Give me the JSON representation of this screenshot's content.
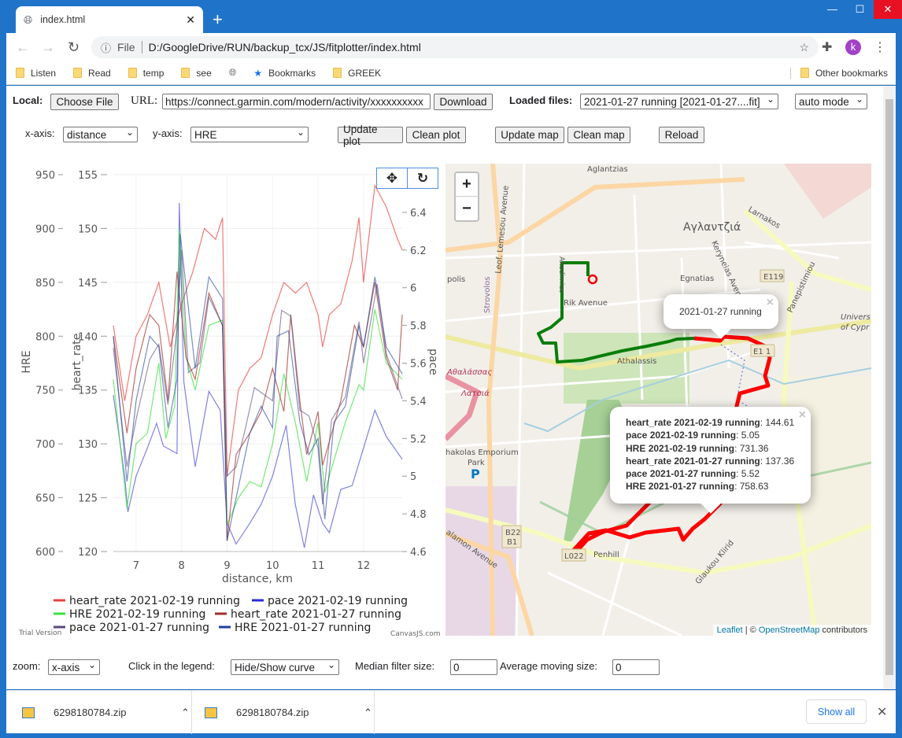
{
  "browser": {
    "tab_title": "index.html",
    "omnibox": {
      "scheme_label": "File",
      "url": "D:/GoogleDrive/RUN/backup_tcx/JS/fitplotter/index.html"
    },
    "bookmarks": [
      "Listen",
      "Read",
      "temp",
      "see",
      "Bookmarks",
      "GREEK"
    ],
    "other_bookmarks": "Other bookmarks",
    "profile_initial": "k",
    "accent": "#1f74c9"
  },
  "controls": {
    "local_label": "Local:",
    "choose_file": "Choose File",
    "url_label": "URL:",
    "url_value": "https://connect.garmin.com/modern/activity/xxxxxxxxxx",
    "download": "Download",
    "loaded_label": "Loaded files:",
    "loaded_value": "2021-01-27 running [2021-01-27....fit]",
    "mode_value": "auto mode",
    "xaxis_label": "x-axis:",
    "xaxis_value": "distance",
    "yaxis_label": "y-axis:",
    "yaxis_value": "HRE",
    "update_plot": "Update plot",
    "clean_plot": "Clean plot",
    "update_map": "Update map",
    "clean_map": "Clean map",
    "reload": "Reload",
    "zoom_label": "zoom:",
    "zoom_value": "x-axis",
    "legend_label": "Click in the legend:",
    "legend_value": "Hide/Show curve",
    "median_label": "Median filter size:",
    "median_value": "0",
    "avg_label": "Average moving size:",
    "avg_value": "0"
  },
  "chart_data": {
    "type": "line",
    "xlabel": "distance, km",
    "xlim": [
      6.5,
      12.85
    ],
    "xticks": [
      7,
      8,
      9,
      10,
      11,
      12
    ],
    "axes": {
      "HRE": {
        "label": "HRE",
        "range": [
          600,
          950
        ],
        "ticks": [
          600,
          650,
          700,
          750,
          800,
          850,
          900,
          950
        ]
      },
      "heart_rate": {
        "label": "heart_rate",
        "range": [
          120,
          155
        ],
        "ticks": [
          120,
          125,
          130,
          135,
          140,
          145,
          150,
          155
        ]
      },
      "pace": {
        "label": "pace",
        "range": [
          4.6,
          6.6
        ],
        "ticks": [
          "4.6",
          "4.8",
          "5",
          "5.2",
          "5.4",
          "5.6",
          "5.8",
          "6",
          "6.2",
          "6.4"
        ]
      }
    },
    "grid": true,
    "legend_placement": "bottom",
    "watermark_left": "Trial Version",
    "watermark_right": "CanvasJS.com",
    "series": [
      {
        "name": "heart_rate 2021-02-19 running",
        "axis": "heart_rate",
        "color": "#e8403f",
        "points": [
          [
            6.5,
            141
          ],
          [
            6.75,
            134
          ],
          [
            7.0,
            140
          ],
          [
            7.25,
            142
          ],
          [
            7.5,
            145
          ],
          [
            7.75,
            139
          ],
          [
            8.0,
            143
          ],
          [
            8.25,
            146
          ],
          [
            8.5,
            150
          ],
          [
            8.75,
            149
          ],
          [
            8.9,
            151
          ],
          [
            9.0,
            127
          ],
          [
            9.25,
            135
          ],
          [
            9.5,
            137
          ],
          [
            9.75,
            138
          ],
          [
            10.0,
            142
          ],
          [
            10.25,
            145
          ],
          [
            10.5,
            144
          ],
          [
            10.75,
            145
          ],
          [
            11.0,
            142
          ],
          [
            11.1,
            139
          ],
          [
            11.25,
            142
          ],
          [
            11.5,
            143
          ],
          [
            11.75,
            147
          ],
          [
            11.9,
            151
          ],
          [
            12.0,
            145
          ],
          [
            12.25,
            154
          ],
          [
            12.5,
            152
          ],
          [
            12.75,
            149
          ],
          [
            12.85,
            148
          ]
        ]
      },
      {
        "name": "pace 2021-02-19 running",
        "axis": "pace",
        "color": "#2b2bd6",
        "points": [
          [
            6.5,
            5.43
          ],
          [
            6.75,
            5.0
          ],
          [
            6.82,
            4.81
          ],
          [
            7.0,
            5.0
          ],
          [
            7.25,
            5.15
          ],
          [
            7.45,
            5.28
          ],
          [
            7.6,
            5.16
          ],
          [
            7.9,
            5.12
          ],
          [
            7.95,
            6.45
          ],
          [
            8.05,
            5.5
          ],
          [
            8.3,
            5.05
          ],
          [
            8.6,
            5.45
          ],
          [
            8.85,
            5.35
          ],
          [
            9.0,
            4.75
          ],
          [
            9.2,
            4.64
          ],
          [
            9.5,
            4.75
          ],
          [
            9.75,
            4.85
          ],
          [
            10.0,
            5.0
          ],
          [
            10.3,
            5.27
          ],
          [
            10.5,
            4.85
          ],
          [
            10.7,
            4.62
          ],
          [
            10.9,
            4.9
          ],
          [
            11.1,
            4.75
          ],
          [
            11.25,
            4.7
          ],
          [
            11.5,
            4.93
          ],
          [
            11.75,
            4.95
          ],
          [
            12.0,
            5.15
          ],
          [
            12.25,
            5.35
          ],
          [
            12.5,
            5.21
          ],
          [
            12.85,
            5.09
          ]
        ]
      },
      {
        "name": "HRE 2021-02-19 running",
        "axis": "HRE",
        "color": "#3be03b",
        "points": [
          [
            6.5,
            760
          ],
          [
            6.8,
            640
          ],
          [
            7.0,
            700
          ],
          [
            7.25,
            710
          ],
          [
            7.5,
            775
          ],
          [
            7.65,
            705
          ],
          [
            7.85,
            735
          ],
          [
            7.95,
            900
          ],
          [
            8.1,
            780
          ],
          [
            8.3,
            750
          ],
          [
            8.6,
            810
          ],
          [
            8.9,
            815
          ],
          [
            9.0,
            625
          ],
          [
            9.25,
            650
          ],
          [
            9.5,
            665
          ],
          [
            9.75,
            660
          ],
          [
            10.0,
            700
          ],
          [
            10.25,
            765
          ],
          [
            10.5,
            720
          ],
          [
            10.75,
            665
          ],
          [
            11.0,
            720
          ],
          [
            11.15,
            655
          ],
          [
            11.35,
            685
          ],
          [
            11.6,
            720
          ],
          [
            11.9,
            755
          ],
          [
            12.0,
            750
          ],
          [
            12.25,
            825
          ],
          [
            12.5,
            775
          ],
          [
            12.85,
            760
          ]
        ]
      },
      {
        "name": "heart_rate 2021-01-27 running",
        "axis": "heart_rate",
        "color": "#a3302a",
        "points": [
          [
            6.5,
            140
          ],
          [
            6.8,
            131
          ],
          [
            7.0,
            137
          ],
          [
            7.3,
            142
          ],
          [
            7.5,
            141
          ],
          [
            7.7,
            134
          ],
          [
            7.9,
            146
          ],
          [
            8.1,
            138
          ],
          [
            8.3,
            136
          ],
          [
            8.6,
            144
          ],
          [
            8.9,
            141
          ],
          [
            9.0,
            121
          ],
          [
            9.2,
            129
          ],
          [
            9.5,
            131
          ],
          [
            9.75,
            133
          ],
          [
            10.0,
            137
          ],
          [
            10.25,
            133
          ],
          [
            10.4,
            142
          ],
          [
            10.6,
            134
          ],
          [
            10.75,
            129
          ],
          [
            11.0,
            133
          ],
          [
            11.1,
            128
          ],
          [
            11.3,
            131
          ],
          [
            11.5,
            134
          ],
          [
            11.8,
            141
          ],
          [
            12.0,
            139
          ],
          [
            12.25,
            145
          ],
          [
            12.5,
            138
          ],
          [
            12.75,
            135
          ],
          [
            12.85,
            142
          ]
        ]
      },
      {
        "name": "pace 2021-01-27 running",
        "axis": "pace",
        "color": "#5a4a7a",
        "points": [
          [
            6.5,
            5.68
          ],
          [
            6.8,
            5.05
          ],
          [
            7.0,
            5.3
          ],
          [
            7.3,
            5.62
          ],
          [
            7.5,
            5.7
          ],
          [
            7.7,
            5.38
          ],
          [
            7.9,
            5.78
          ],
          [
            8.0,
            6.2
          ],
          [
            8.15,
            5.55
          ],
          [
            8.4,
            5.6
          ],
          [
            8.6,
            5.95
          ],
          [
            8.9,
            5.8
          ],
          [
            9.0,
            5.0
          ],
          [
            9.2,
            5.05
          ],
          [
            9.4,
            5.25
          ],
          [
            9.6,
            5.47
          ],
          [
            10.0,
            5.4
          ],
          [
            10.2,
            5.88
          ],
          [
            10.4,
            5.85
          ],
          [
            10.6,
            5.35
          ],
          [
            10.8,
            5.32
          ],
          [
            11.0,
            5.15
          ],
          [
            11.1,
            4.85
          ],
          [
            11.3,
            5.3
          ],
          [
            11.6,
            5.42
          ],
          [
            11.9,
            5.82
          ],
          [
            12.0,
            5.6
          ],
          [
            12.3,
            6.02
          ],
          [
            12.5,
            5.65
          ],
          [
            12.85,
            5.41
          ]
        ]
      },
      {
        "name": "HRE 2021-01-27 running",
        "axis": "HRE",
        "color": "#1f3f9a",
        "points": [
          [
            6.5,
            800
          ],
          [
            6.8,
            665
          ],
          [
            7.0,
            740
          ],
          [
            7.3,
            800
          ],
          [
            7.5,
            790
          ],
          [
            7.7,
            715
          ],
          [
            7.9,
            760
          ],
          [
            7.97,
            895
          ],
          [
            8.1,
            845
          ],
          [
            8.3,
            770
          ],
          [
            8.6,
            855
          ],
          [
            8.9,
            835
          ],
          [
            9.0,
            610
          ],
          [
            9.2,
            650
          ],
          [
            9.5,
            710
          ],
          [
            9.75,
            735
          ],
          [
            10.0,
            715
          ],
          [
            10.1,
            800
          ],
          [
            10.35,
            805
          ],
          [
            10.6,
            720
          ],
          [
            10.8,
            690
          ],
          [
            11.0,
            705
          ],
          [
            11.15,
            630
          ],
          [
            11.35,
            720
          ],
          [
            11.6,
            735
          ],
          [
            11.9,
            810
          ],
          [
            12.0,
            790
          ],
          [
            12.25,
            855
          ],
          [
            12.5,
            790
          ],
          [
            12.85,
            765
          ]
        ]
      }
    ]
  },
  "map": {
    "labels": [
      "Aglantzias",
      "Αγλαντζιά",
      "Larnakos",
      "Leof. Lemesou Avenue",
      "Akadimias",
      "Rik Avenue",
      "Egnatias",
      "Kerynеias Avenue",
      "E119",
      "Panepistimiou",
      "Univers",
      "of Cypr",
      "Strovolos",
      "polis",
      "Athalassis",
      "E1 1",
      "Αθαλάσσας",
      "Λατσιά",
      "hakolas Emporium",
      "Park",
      "Penhill",
      "B22",
      "B1",
      "L022",
      "Glaukou Klirid",
      "alamon Avenue"
    ],
    "zoom_in": "+",
    "zoom_out": "−",
    "route_colors": {
      "2021-01-27": "#0a7d0a",
      "2021-02-19": "#ff0000"
    },
    "popup_title": "2021-01-27 running",
    "popup_values": [
      {
        "key": "heart_rate",
        "name": "2021-02-19 running",
        "value": "144.61"
      },
      {
        "key": "pace",
        "name": "2021-02-19 running",
        "value": "5.05"
      },
      {
        "key": "HRE",
        "name": "2021-02-19 running",
        "value": "731.36"
      },
      {
        "key": "heart_rate",
        "name": "2021-01-27 running",
        "value": "137.36"
      },
      {
        "key": "pace",
        "name": "2021-01-27 running",
        "value": "5.52"
      },
      {
        "key": "HRE",
        "name": "2021-01-27 running",
        "value": "758.63"
      }
    ],
    "attribution": {
      "leaflet": "Leaflet",
      "sep": " | © ",
      "osm": "OpenStreetMap",
      "suffix": " contributors"
    }
  },
  "downloads": {
    "items": [
      "6298180784.zip",
      "6298180784.zip"
    ],
    "show_all": "Show all"
  }
}
